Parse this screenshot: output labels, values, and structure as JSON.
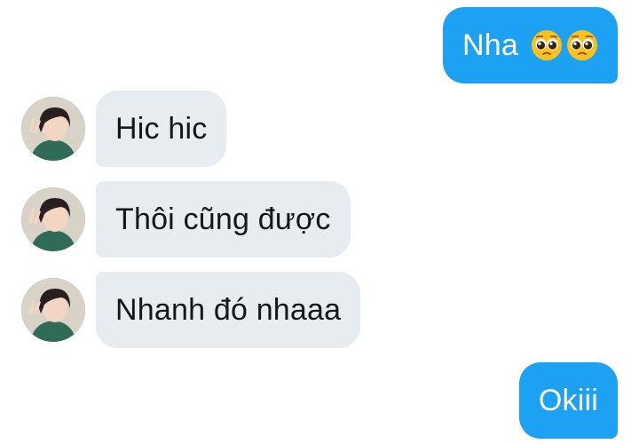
{
  "conversation": {
    "messages": [
      {
        "direction": "outgoing",
        "text": "Nha",
        "emojis": [
          "pleading-face",
          "pleading-face"
        ]
      },
      {
        "direction": "incoming",
        "text": "Hic hic",
        "avatar": "user-avatar"
      },
      {
        "direction": "incoming",
        "text": "Thôi cũng được",
        "avatar": "user-avatar"
      },
      {
        "direction": "incoming",
        "text": "Nhanh đó nhaaa",
        "avatar": "user-avatar"
      },
      {
        "direction": "outgoing",
        "text": "Okiii"
      }
    ]
  },
  "colors": {
    "outgoing_bubble": "#1da1f2",
    "incoming_bubble": "#e6ecf0",
    "incoming_text": "#14171a",
    "outgoing_text": "#ffffff"
  }
}
